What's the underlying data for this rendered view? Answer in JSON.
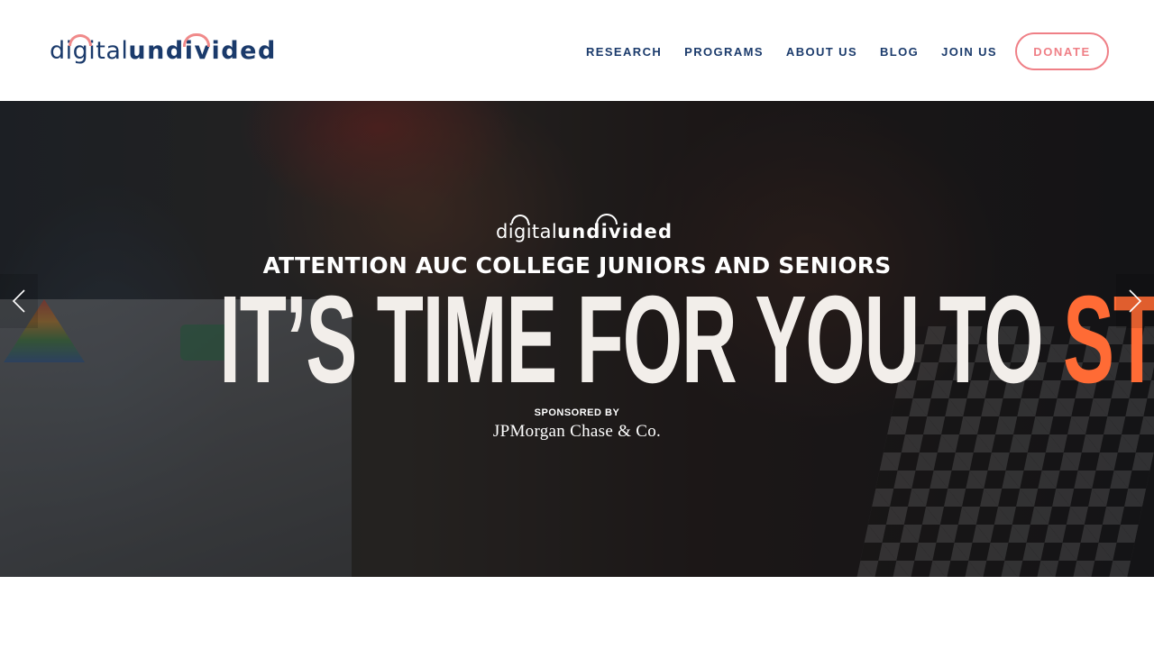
{
  "header": {
    "logo": {
      "part1": "digital",
      "part2": "undivided"
    },
    "nav": [
      {
        "label": "RESEARCH"
      },
      {
        "label": "PROGRAMS"
      },
      {
        "label": "ABOUT US"
      },
      {
        "label": "BLOG"
      },
      {
        "label": "JOIN US"
      }
    ],
    "donate_label": "DONATE"
  },
  "hero": {
    "logo": {
      "part1": "digital",
      "part2": "undivided"
    },
    "eyebrow": "ATTENTION AUC COLLEGE JUNIORS AND SENIORS",
    "headline_main": "IT’S TIME FOR YOU TO ",
    "headline_accent": "START",
    "sponsor_label": "SPONSORED BY",
    "sponsor_name": "JPMorgan Chase & Co.",
    "prev_icon": "chevron-left-icon",
    "next_icon": "chevron-right-icon"
  },
  "colors": {
    "brand_navy": "#1a3a6b",
    "brand_coral": "#ef7f86",
    "accent_orange": "#ff6b35"
  }
}
